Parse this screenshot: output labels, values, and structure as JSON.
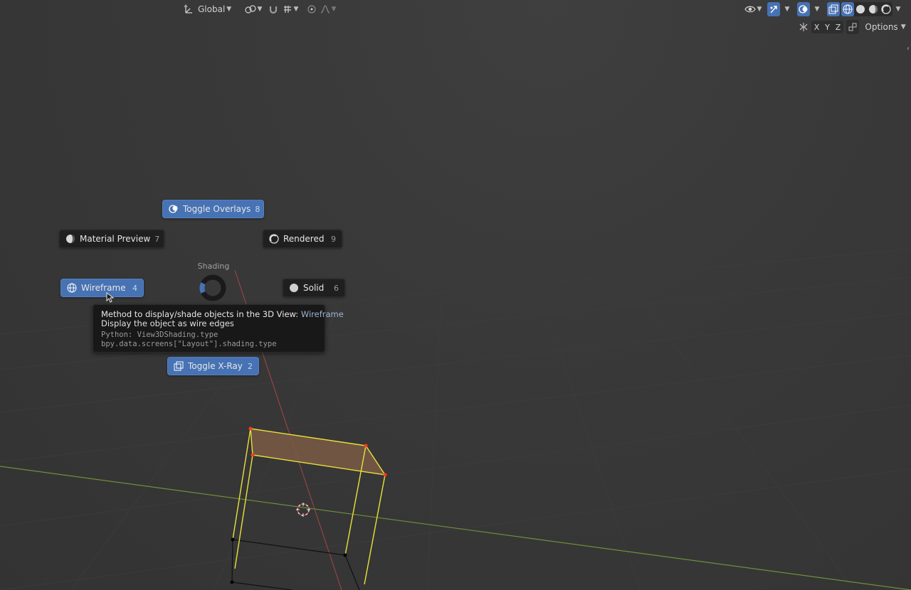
{
  "header_left": {
    "transform_orientation": "Global"
  },
  "header_right": {
    "axes": [
      "X",
      "Y",
      "Z"
    ],
    "options_label": "Options"
  },
  "pie_menu": {
    "title": "Shading",
    "items": [
      {
        "label": "Toggle Overlays",
        "key": "8"
      },
      {
        "label": "Material Preview",
        "key": "7"
      },
      {
        "label": "Rendered",
        "key": "9"
      },
      {
        "label": "Wireframe",
        "key": "4"
      },
      {
        "label": "Solid",
        "key": "6"
      },
      {
        "label": "Toggle X-Ray",
        "key": "2"
      }
    ]
  },
  "tooltip": {
    "line1_prefix": "Method to display/shade objects in the 3D View: ",
    "line1_value": "Wireframe",
    "line2": "Display the object as wire edges",
    "python_line": "Python: View3DShading.type",
    "path_line": "bpy.data.screens[\"Layout\"].shading.type"
  },
  "colors": {
    "accent": "#4772b3",
    "selection_edge": "#e8e23a",
    "selected_face": "#7a5a44",
    "vertex_selected": "#ff3b1f",
    "x_axis": "#c04a4a",
    "y_axis": "#7ea53a"
  }
}
